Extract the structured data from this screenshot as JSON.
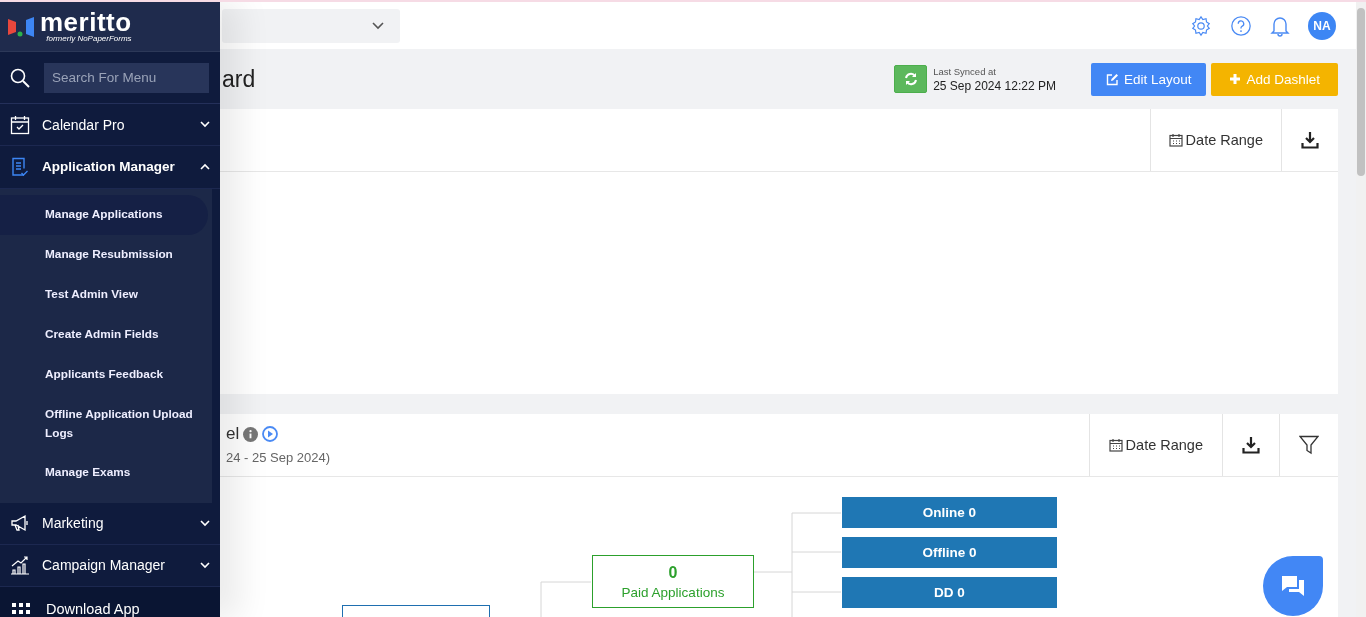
{
  "logo": {
    "name": "meritto",
    "tagline": "formerly NoPaperForms"
  },
  "sidebar": {
    "search": {
      "placeholder": "Search For Menu"
    },
    "items": [
      {
        "label": "Calendar Pro",
        "kind": "calendar",
        "expanded": false
      },
      {
        "label": "Application Manager",
        "kind": "document",
        "expanded": true,
        "children": [
          {
            "label": "Manage Applications",
            "selected": true
          },
          {
            "label": "Manage Resubmission",
            "selected": false
          },
          {
            "label": "Test Admin View",
            "selected": false
          },
          {
            "label": "Create Admin Fields",
            "selected": false
          },
          {
            "label": "Applicants Feedback",
            "selected": false
          },
          {
            "label": "Offline Application Upload Logs",
            "selected": false
          },
          {
            "label": "Manage Exams",
            "selected": false
          }
        ]
      },
      {
        "label": "Marketing",
        "kind": "megaphone",
        "expanded": false
      },
      {
        "label": "Campaign Manager",
        "kind": "chart",
        "expanded": false
      }
    ],
    "footer": {
      "label": "Download App"
    }
  },
  "topbar": {
    "avatar": "NA"
  },
  "header": {
    "title": "ard",
    "sync": {
      "label": "Last Synced at",
      "time": "25 Sep 2024 12:22 PM"
    },
    "buttons": [
      {
        "label": "Edit Layout",
        "kind": "edit"
      },
      {
        "label": "Add Dashlet",
        "kind": "add"
      }
    ]
  },
  "cards": [
    {
      "date_range": "Date Range",
      "filter": false
    },
    {
      "title": "el",
      "subtitle": "24 - 25 Sep 2024)",
      "date_range": "Date Range",
      "filter": true
    }
  ],
  "funnel": {
    "paid": {
      "value": "0",
      "label": "Paid Applications"
    },
    "channels": [
      "Online 0",
      "Offline 0",
      "DD 0"
    ]
  }
}
